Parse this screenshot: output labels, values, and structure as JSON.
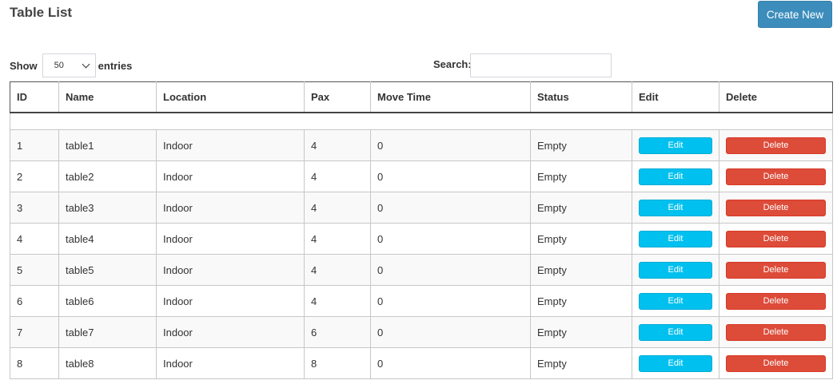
{
  "header": {
    "title": "Table List",
    "create_label": "Create New"
  },
  "controls": {
    "show_label": "Show",
    "entries_value": "50",
    "entries_label": "entries",
    "search_label": "Search:",
    "search_value": "",
    "search_placeholder": ""
  },
  "colors": {
    "primary": "#3c8dbc",
    "info": "#00c0ef",
    "danger": "#dd4b39"
  },
  "table": {
    "columns": [
      "ID",
      "Name",
      "Location",
      "Pax",
      "Move Time",
      "Status",
      "Edit",
      "Delete"
    ],
    "edit_label": "Edit",
    "delete_label": "Delete",
    "rows": [
      {
        "id": "1",
        "name": "table1",
        "location": "Indoor",
        "pax": "4",
        "move_time": "0",
        "status": "Empty"
      },
      {
        "id": "2",
        "name": "table2",
        "location": "Indoor",
        "pax": "4",
        "move_time": "0",
        "status": "Empty"
      },
      {
        "id": "3",
        "name": "table3",
        "location": "Indoor",
        "pax": "4",
        "move_time": "0",
        "status": "Empty"
      },
      {
        "id": "4",
        "name": "table4",
        "location": "Indoor",
        "pax": "4",
        "move_time": "0",
        "status": "Empty"
      },
      {
        "id": "5",
        "name": "table5",
        "location": "Indoor",
        "pax": "4",
        "move_time": "0",
        "status": "Empty"
      },
      {
        "id": "6",
        "name": "table6",
        "location": "Indoor",
        "pax": "4",
        "move_time": "0",
        "status": "Empty"
      },
      {
        "id": "7",
        "name": "table7",
        "location": "Indoor",
        "pax": "6",
        "move_time": "0",
        "status": "Empty"
      },
      {
        "id": "8",
        "name": "table8",
        "location": "Indoor",
        "pax": "8",
        "move_time": "0",
        "status": "Empty"
      }
    ]
  }
}
